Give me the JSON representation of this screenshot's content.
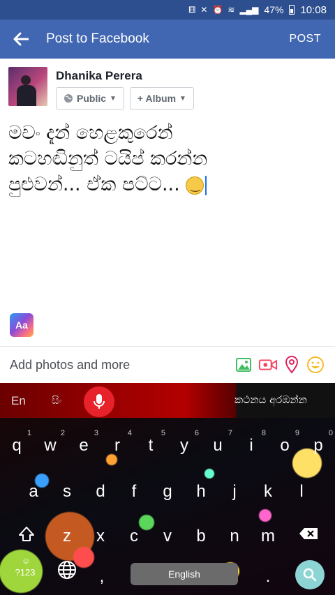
{
  "status": {
    "battery": "47%",
    "time": "10:08"
  },
  "appbar": {
    "title": "Post to Facebook",
    "post_label": "POST"
  },
  "user": {
    "name": "Dhanika Perera",
    "privacy": "Public",
    "album": "+ Album"
  },
  "composer": {
    "lines": [
      "මචං දැන් හෙළකුරෙන්",
      "කටහඬිනුත් ටයිප් කරන්න",
      "පුළුවන්... ඒක පට්ට..."
    ]
  },
  "aa_label": "Aa",
  "addbar": {
    "label": "Add photos and more",
    "icons": [
      "photo-icon",
      "video-icon",
      "location-icon",
      "feeling-icon"
    ]
  },
  "keyboard": {
    "lang_en": "En",
    "lang_si": "සිං",
    "suggestion": "කථනය අරඹන්න",
    "row1": [
      [
        "q",
        "1"
      ],
      [
        "w",
        "2"
      ],
      [
        "e",
        "3"
      ],
      [
        "r",
        "4"
      ],
      [
        "t",
        "5"
      ],
      [
        "y",
        "6"
      ],
      [
        "u",
        "7"
      ],
      [
        "i",
        "8"
      ],
      [
        "o",
        "9"
      ],
      [
        "p",
        "0"
      ]
    ],
    "row2": [
      "a",
      "s",
      "d",
      "f",
      "g",
      "h",
      "j",
      "k",
      "l"
    ],
    "row3": [
      "z",
      "x",
      "c",
      "v",
      "b",
      "n",
      "m"
    ],
    "symbols": "?123",
    "comma": ",",
    "period": ".",
    "space_label": "English"
  },
  "colors": {
    "appbar": "#4267b2",
    "statusbar": "#2d4f8f",
    "mic": "#e8222b"
  }
}
